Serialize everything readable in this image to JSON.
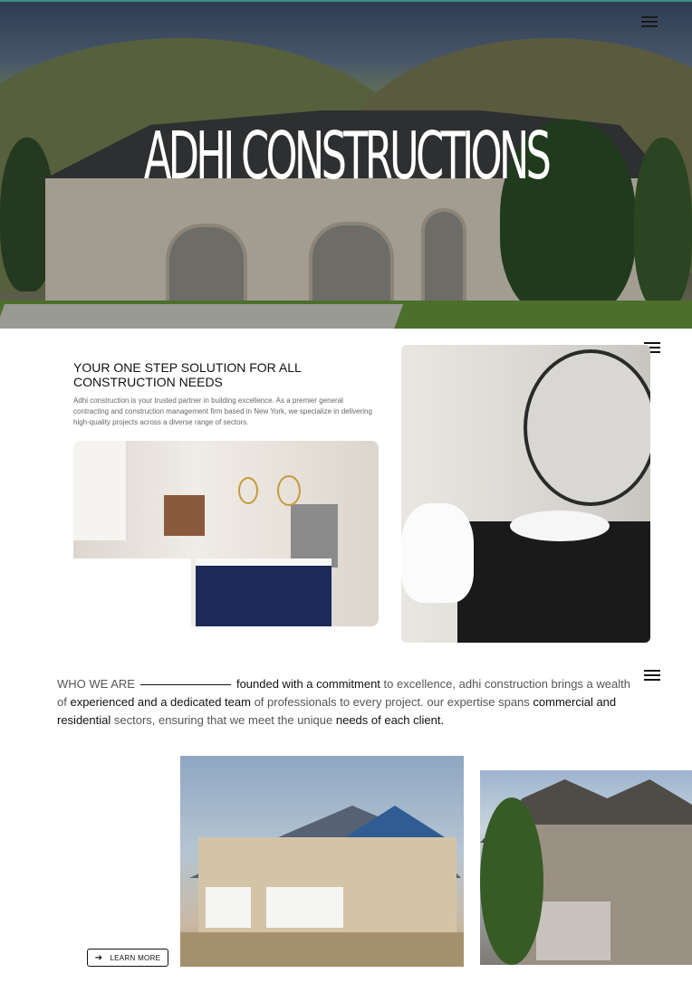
{
  "hero": {
    "title": "ADHI CONSTRUCTIONS"
  },
  "intro": {
    "headline": "YOUR ONE STEP SOLUTION FOR ALL CONSTRUCTION NEEDS",
    "body": "Adhi construction is your trusted partner in building excellence. As a premier general contracting and construction management firm based in New York, we specialize in delivering high-quality projects across a diverse range of sectors."
  },
  "about": {
    "label": "WHO WE ARE",
    "segments": [
      {
        "text": "founded with a commitment",
        "strong": true
      },
      {
        "text": " to excellence, adhi construction brings a wealth of ",
        "strong": false
      },
      {
        "text": "experienced and a dedicated team",
        "strong": true
      },
      {
        "text": " of professionals to every project. our expertise spans ",
        "strong": false
      },
      {
        "text": "commercial and residential",
        "strong": true
      },
      {
        "text": " sectors, ensuring that we meet the unique ",
        "strong": false
      },
      {
        "text": "needs of each client.",
        "strong": true
      }
    ]
  },
  "cta": {
    "label": "LEARN MORE",
    "icon": "arrow-right-icon"
  },
  "icons": {
    "menu": "hamburger-menu-icon"
  },
  "colors": {
    "accent_top_border": "#3d8f86",
    "text_dark": "#111111",
    "text_muted": "#555555"
  }
}
